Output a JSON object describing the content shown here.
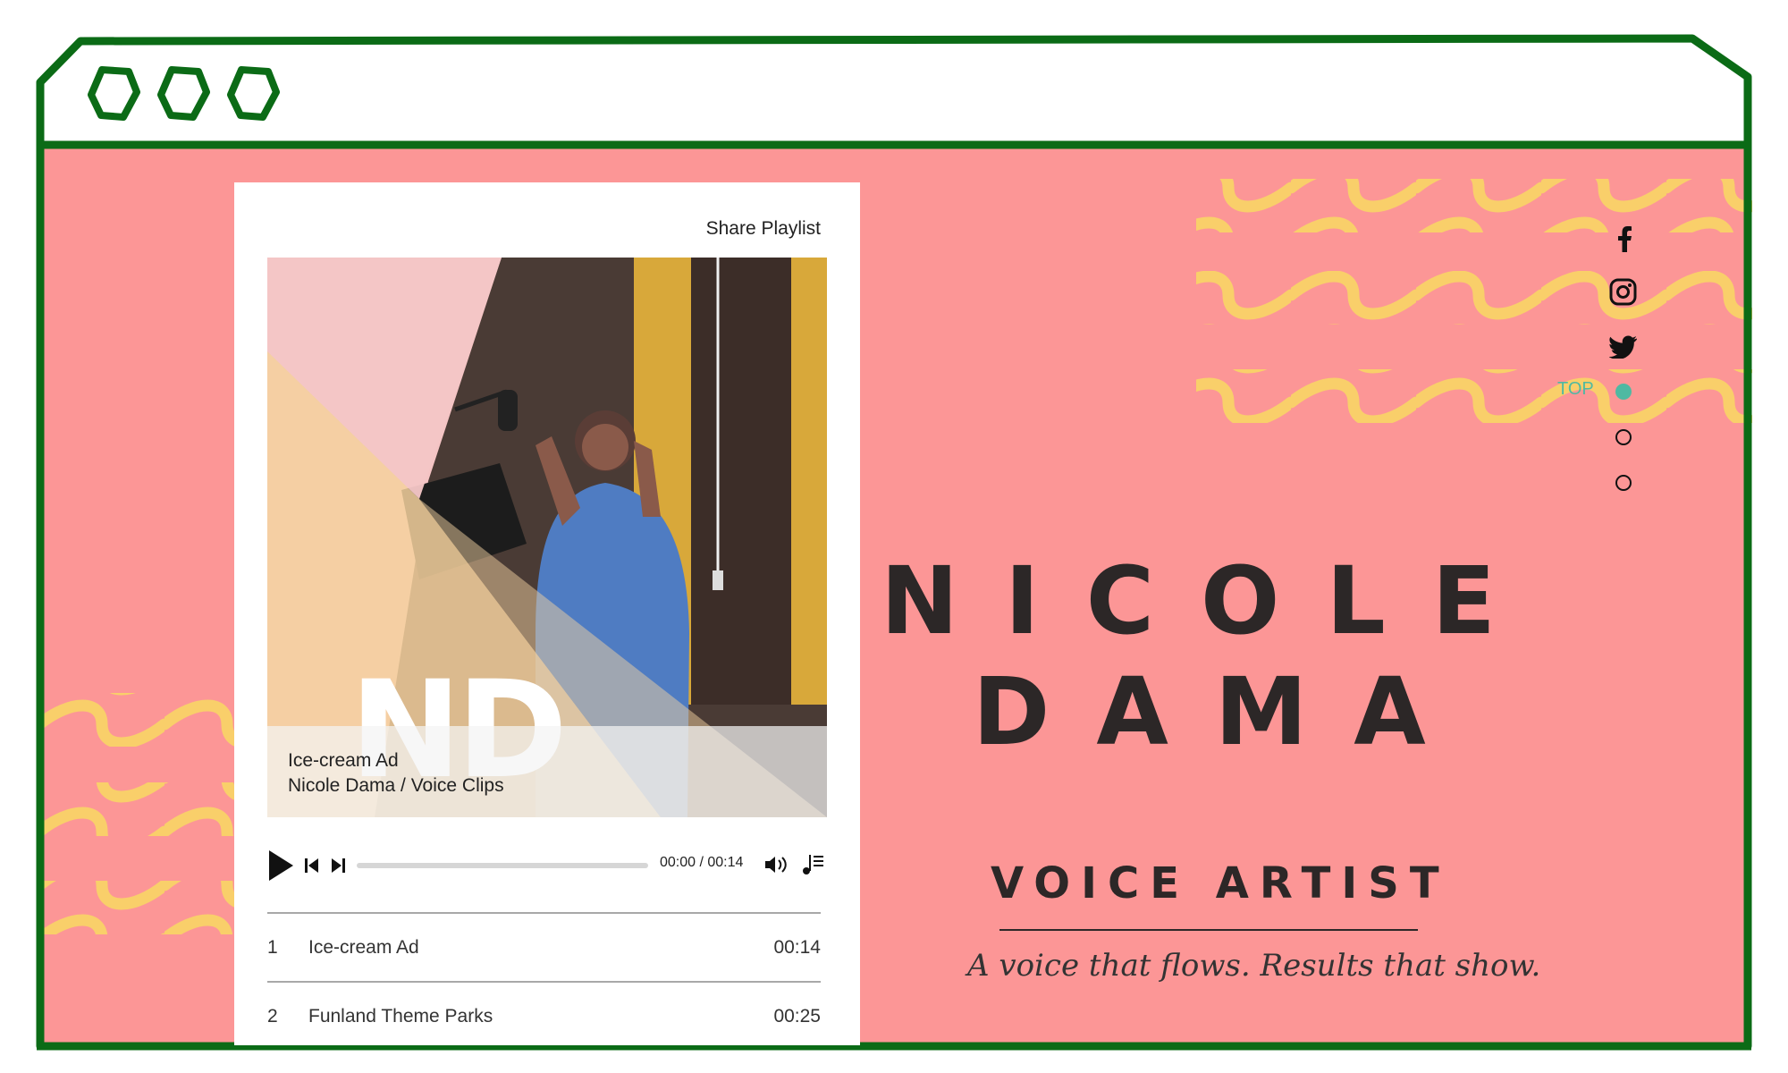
{
  "player": {
    "share_label": "Share Playlist",
    "cover_initials": "ND",
    "now_playing_title": "Ice-cream Ad",
    "now_playing_subtitle": "Nicole Dama / Voice Clips",
    "time": "00:00 / 00:14",
    "progress": 0,
    "tracks": [
      {
        "num": "1",
        "name": "Ice-cream Ad",
        "duration": "00:14"
      },
      {
        "num": "2",
        "name": "Funland Theme Parks",
        "duration": "00:25"
      }
    ]
  },
  "hero": {
    "name_line1": "NICOLE",
    "name_line2": "DAMA",
    "title": "VOICE ARTIST",
    "tagline": "A voice that flows. Results that show."
  },
  "sidebar": {
    "social": [
      "facebook-icon",
      "instagram-icon",
      "twitter-icon"
    ],
    "top_label": "TOP",
    "nav_dots": 3,
    "active_dot": 0
  },
  "colors": {
    "frame": "#0b6b16",
    "page_background": "#fc9696",
    "waves": "#f9cf6a",
    "accent": "#4fb9a2",
    "text": "#2c2727"
  }
}
